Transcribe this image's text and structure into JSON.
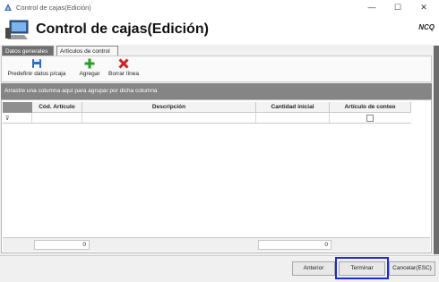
{
  "window": {
    "title": "Control de cajas(Edición)",
    "minimize_glyph": "—",
    "maximize_glyph": "☐",
    "close_glyph": "✕"
  },
  "header": {
    "title": "Control de cajas(Edición)",
    "logo_text": "NCQ"
  },
  "tabs": [
    {
      "label": "Datos generales",
      "active": false
    },
    {
      "label": "Artículos de control",
      "active": true
    }
  ],
  "toolbar": {
    "predefinir_label": "Predefinir datos p/caja",
    "agregar_label": "Agregar",
    "borrar_label": "Borrar línea"
  },
  "grid": {
    "group_panel_text": "Arrastre una columna aquí para agrupar por dicha columna",
    "columns": [
      "Cód. Artículo",
      "Descripción",
      "Cantidad inicial",
      "Artículo de conteo"
    ],
    "filter_glyph": "⊽",
    "summary": {
      "cod_articulo": "0",
      "cantidad_inicial": "0"
    }
  },
  "buttons": {
    "anterior": "Anterior",
    "terminar": "Terminar",
    "cancelar": "Cancelar(ESC)"
  },
  "colors": {
    "highlight": "#1a2bd8",
    "add_icon": "#2a9d2a",
    "delete_icon": "#d02020",
    "save_icon": "#2b6fc0"
  },
  "icons": [
    "app-icon",
    "pc-icon",
    "save-icon",
    "add-icon",
    "delete-icon",
    "filter-icon"
  ]
}
